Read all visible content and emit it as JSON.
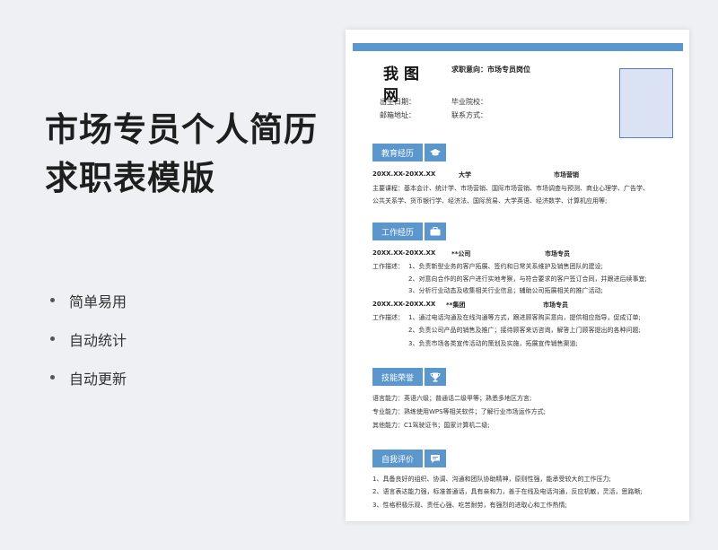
{
  "promo": {
    "title": "市场专员个人简历求职表模版",
    "features": [
      "简单易用",
      "自动统计",
      "自动更新"
    ]
  },
  "resume": {
    "name": "我图网",
    "intent": "求职意向：市场专员岗位",
    "birth_label": "出生日期：",
    "school_label": "毕业院校：",
    "email_label": "邮箱地址：",
    "contact_label": "联系方式：",
    "education": {
      "heading": "教育经历",
      "period": "20XX.XX-20XX.XX",
      "school": "大学",
      "major": "市场营销",
      "courses_line1": "主要课程：基本会计、统计学、市场营销、国际市场营销、市场调查与预测、商业心理学、广告学、",
      "courses_line2": "公共关系学、货币银行学、经济法、国际贸易、大学英语、经济数学、计算机应用等;"
    },
    "work": {
      "heading": "工作经历",
      "jobs": [
        {
          "period": "20XX.XX-20XX.XX",
          "company": "**公司",
          "position": "市场专员",
          "desc_label": "工作描述：",
          "items": [
            "1、负责新型业务的客户拓展、签约和日常关系维护及销售团队的建设;",
            "2、对意向合作的的客户进行实地考察，与符合要求的客户签订合同，并跟进后续事宜;",
            "3、分析行业动态及收集相关行业信息；辅助公司拓展相关的推广活动;"
          ]
        },
        {
          "period": "20XX.XX-20XX.XX",
          "company": "**集团",
          "position": "市场专员",
          "desc_label": "工作描述：",
          "items": [
            "1、通过电话沟通及在线沟通等方式，跟进顾客购买意向，提供相应指导，促成订单;",
            "2、负责公司产品的销售及推广；接待顾客来访咨询，解答上门顾客提出的各种问题;",
            "3、负责市场各类宣传活动的策划及实施，拓展宣传销售渠道;"
          ]
        }
      ]
    },
    "skills": {
      "heading": "技能荣誉",
      "lines": [
        "语言能力：英语六级；普通话二级甲等；熟悉多地区方言;",
        "专业能力：熟练使用WPS等相关软件；了解行业市场运作方式;",
        "其他能力：C1驾驶证书；国家计算机二级;"
      ]
    },
    "self": {
      "heading": "自我评价",
      "lines": [
        "1、具备良好的组织、协调、沟通和团队协助精神，原则性强，能承受较大的工作压力;",
        "2、语言表达能力强，标准普通话，具有亲和力，善于在线及电话沟通，反应机敏，灵活，思路晰;",
        "3、性格积极乐观、责任心强、吃苦耐劳，有强烈的进取心和工作热情;"
      ]
    },
    "colors": {
      "accent": "#5b96cc",
      "photo_bg": "#dbe2f3"
    },
    "icons": [
      "graduation-cap-icon",
      "briefcase-icon",
      "trophy-icon",
      "chat-bubble-icon"
    ]
  }
}
